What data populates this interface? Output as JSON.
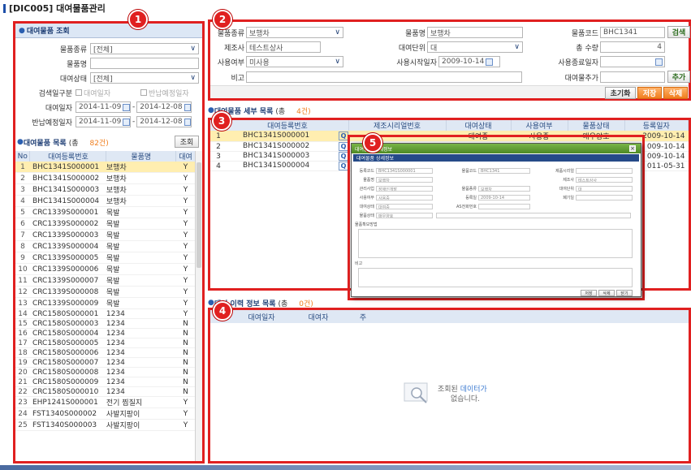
{
  "page_title": "[DIC005] 대여물품관리",
  "badges": [
    "1",
    "2",
    "3",
    "4",
    "5"
  ],
  "search_panel": {
    "title": "대여물품 조회",
    "fields": [
      {
        "label": "물품종류",
        "value": "[전체]",
        "type": "select"
      },
      {
        "label": "물품명",
        "value": "",
        "type": "text"
      },
      {
        "label": "대여상태",
        "value": "[전체]",
        "type": "select"
      }
    ],
    "search_type_label": "검색일구분",
    "search_type_opt1": "대여일자",
    "search_type_opt2": "반납예정일자",
    "rent_date_label": "대여일자",
    "rent_date_from": "2014-11-09",
    "rent_date_to": "2014-12-08",
    "return_date_label": "반납예정일자",
    "return_date_from": "2014-11-09",
    "return_date_to": "2014-12-08",
    "search_button": "조회"
  },
  "list_panel": {
    "title": "대여물품 목록",
    "count_prefix": "(총",
    "count": "82건)",
    "columns": [
      "No",
      "대여등록번호",
      "물품명",
      "대여"
    ],
    "rows": [
      [
        "1",
        "BHC1341S000001",
        "보행차",
        "Y"
      ],
      [
        "2",
        "BHC1341S000002",
        "보행차",
        "Y"
      ],
      [
        "3",
        "BHC1341S000003",
        "보행차",
        "Y"
      ],
      [
        "4",
        "BHC1341S000004",
        "보행차",
        "Y"
      ],
      [
        "5",
        "CRC1339S000001",
        "목발",
        "Y"
      ],
      [
        "6",
        "CRC1339S000002",
        "목발",
        "Y"
      ],
      [
        "7",
        "CRC1339S000003",
        "목발",
        "Y"
      ],
      [
        "8",
        "CRC1339S000004",
        "목발",
        "Y"
      ],
      [
        "9",
        "CRC1339S000005",
        "목발",
        "Y"
      ],
      [
        "10",
        "CRC1339S000006",
        "목발",
        "Y"
      ],
      [
        "11",
        "CRC1339S000007",
        "목발",
        "Y"
      ],
      [
        "12",
        "CRC1339S000008",
        "목발",
        "Y"
      ],
      [
        "13",
        "CRC1339S000009",
        "목발",
        "Y"
      ],
      [
        "14",
        "CRC1580S000001",
        "1234",
        "Y"
      ],
      [
        "15",
        "CRC1580S000003",
        "1234",
        "N"
      ],
      [
        "16",
        "CRC1580S000004",
        "1234",
        "N"
      ],
      [
        "17",
        "CRC1580S000005",
        "1234",
        "N"
      ],
      [
        "18",
        "CRC1580S000006",
        "1234",
        "N"
      ],
      [
        "19",
        "CRC1580S000007",
        "1234",
        "N"
      ],
      [
        "20",
        "CRC1580S000008",
        "1234",
        "N"
      ],
      [
        "21",
        "CRC1580S000009",
        "1234",
        "N"
      ],
      [
        "22",
        "CRC1580S000010",
        "1234",
        "N"
      ],
      [
        "23",
        "EHP1241S000001",
        "전기 찜질지",
        "Y"
      ],
      [
        "24",
        "FST1340S000002",
        "사발지팡이",
        "Y"
      ],
      [
        "25",
        "FST1340S000003",
        "사발지팡이",
        "Y"
      ]
    ]
  },
  "detail_form": {
    "kind_label": "물품종류",
    "kind_value": "보행차",
    "name_label": "물품명",
    "name_value": "보행차",
    "code_label": "물품코드",
    "code_value": "BHC1341",
    "search_btn": "검색",
    "maker_label": "제조사",
    "maker_value": "테스트상사",
    "unit_label": "대여단위",
    "unit_value": "대",
    "total_label": "총 수량",
    "total_value": "4",
    "use_label": "사용여부",
    "use_value": "미사용",
    "start_label": "사용시작일자",
    "start_value": "2009-10-14",
    "end_label": "사용종료일자",
    "end_value": "",
    "note_label": "비고",
    "note_value": "",
    "add_label": "대여물추가",
    "add_btn": "추가",
    "reset_btn": "초기화",
    "save_btn": "저장",
    "delete_btn": "삭제"
  },
  "items_panel": {
    "title": "대여물품 세부 목록",
    "count_prefix": "(총",
    "count": "4건)",
    "columns": [
      "대여등록번호",
      "제조시리얼번호",
      "대여상태",
      "사용여부",
      "물품상태",
      "등록일자"
    ],
    "rows": [
      {
        "no": "1",
        "id": "BHC1341S000001",
        "status": "대여중",
        "use": "사용중",
        "cond": "매우양호",
        "date": "2009-10-14"
      },
      {
        "no": "2",
        "id": "BHC1341S000002",
        "status": "",
        "use": "",
        "cond": "",
        "date": "009-10-14"
      },
      {
        "no": "3",
        "id": "BHC1341S000003",
        "status": "",
        "use": "",
        "cond": "",
        "date": "009-10-14"
      },
      {
        "no": "4",
        "id": "BHC1341S000004",
        "status": "",
        "use": "",
        "cond": "",
        "date": "011-05-31"
      }
    ]
  },
  "history_panel": {
    "title": "대여 이력 정보 목록",
    "count_prefix": "(총",
    "count": "0건)",
    "columns": [
      "대여일자",
      "대여자",
      "주"
    ],
    "empty_line1": "조회된",
    "empty_line1b": "데이터가",
    "empty_line2": "없습니다."
  },
  "dialog": {
    "title": "대여물품 상세정보",
    "sub": "대여물품 상세정보",
    "f1l": "등록코드",
    "f1v": "BHC1341S000001",
    "f2l": "물품코드",
    "f2v": "BHC1341",
    "f3l": "제품시리얼",
    "f3v": "",
    "f4l": "물품명",
    "f4v": "보행차",
    "f5l": "제조사",
    "f5v": "테스트상사",
    "f6l": "관리사업",
    "f6v": "장애인개발",
    "f7l": "물품종류",
    "f7v": "보행차",
    "f8l": "대여단위",
    "f8v": "대",
    "f9l": "사용여부",
    "f9v": "사용중",
    "f10l": "등록일",
    "f10v": "2009-10-14",
    "f11l": "폐기일",
    "f11v": "",
    "f12l": "대여상태",
    "f12v": "대여중",
    "f13l": "AS전화번호",
    "f13v": "",
    "f14l": "물품상태",
    "f14v": "매우양호",
    "area1": "물품확보방법",
    "area2": "비고",
    "b_save": "저장",
    "b_del": "삭제",
    "b_close": "닫기"
  }
}
